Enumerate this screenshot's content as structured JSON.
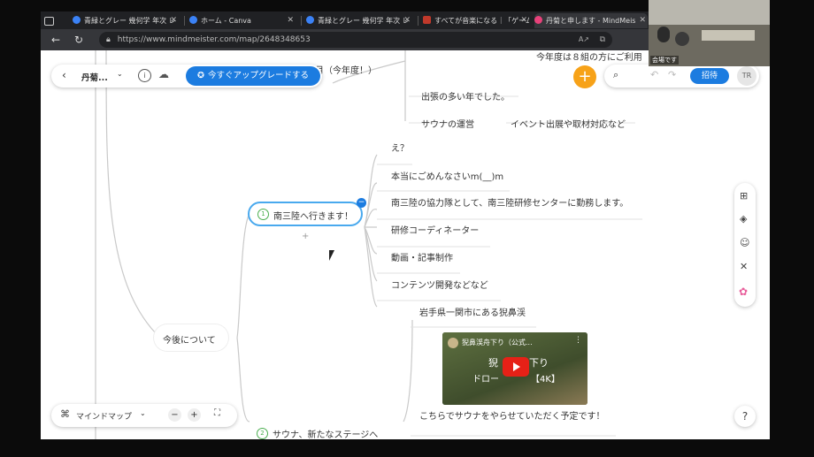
{
  "browser": {
    "tabs": [
      {
        "title": "青緑とグレー 幾何学 年次 レ"
      },
      {
        "title": "ホーム - Canva"
      },
      {
        "title": "青緑とグレー 幾何学 年次 レ"
      },
      {
        "title": "すべてが音楽になる｜「ゲーム"
      },
      {
        "title": "丹菊と申します - MindMeis"
      }
    ],
    "url": "https://www.mindmeister.com/map/2648348653"
  },
  "toolbar": {
    "map_title": "丹菊...",
    "upgrade_label": "今すぐアップグレードする",
    "invite_label": "招待",
    "avatar_initials": "TR"
  },
  "map": {
    "top_partial_1": "月（今年度！）",
    "top_partial_2": "今年度は８組の方にご利用",
    "busy_year": "出張の多い年でした。",
    "sauna_ops": "サウナの運営",
    "event_work": "イベント出展や取材対応など",
    "node1_number": "1",
    "node1_label": "南三陸へ行きます！",
    "children1": [
      "え？",
      "本当にごめんなさいm(__)m",
      "南三陸の協力隊として、南三陸研修センターに勤務します。",
      "研修コーディネーター",
      "動画・記事制作",
      "コンテンツ開発などなど"
    ],
    "parent_label": "今後について",
    "place_label": "岩手県一関市にある猊鼻渓",
    "video_title": "猊鼻渓舟下り（公式...",
    "video_overlay_1": "猊",
    "video_overlay_1b": "下り",
    "video_overlay_2": "ドロー",
    "video_overlay_3": "【4K】",
    "sauna_plan": "こちらでサウナをやらせていただく予定です！",
    "node2_number": "2",
    "node2_label": "サウナ、新たなステージへ"
  },
  "bottom": {
    "view_label": "マインドマップ"
  },
  "webcam": {
    "caption": "会場です"
  }
}
